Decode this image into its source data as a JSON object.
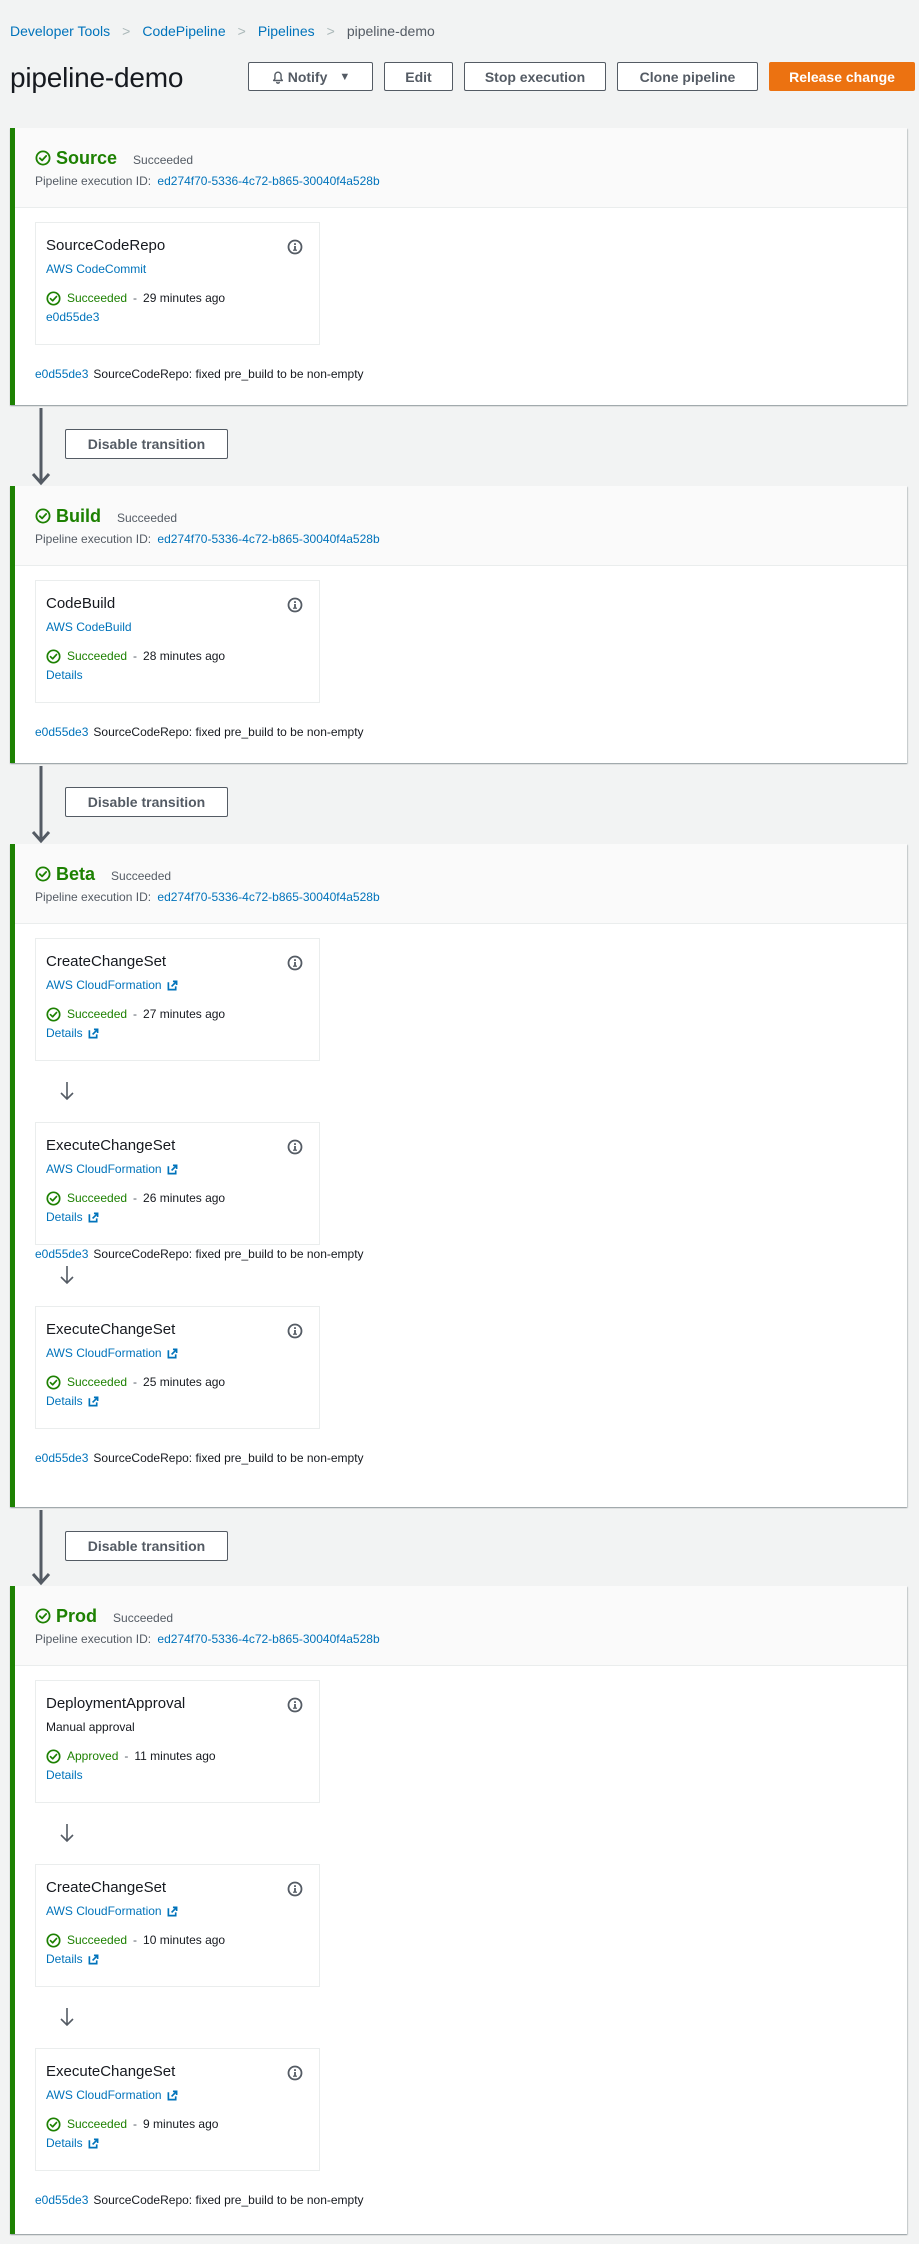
{
  "breadcrumb": [
    {
      "label": "Developer Tools",
      "link": true
    },
    {
      "label": "CodePipeline",
      "link": true
    },
    {
      "label": "Pipelines",
      "link": true
    },
    {
      "label": "pipeline-demo",
      "link": false
    }
  ],
  "page_title": "pipeline-demo",
  "toolbar": {
    "notify_label": "Notify",
    "edit_label": "Edit",
    "stop_label": "Stop execution",
    "clone_label": "Clone pipeline",
    "release_label": "Release change"
  },
  "transition_label": "Disable transition",
  "exec_id_label": "Pipeline execution ID:",
  "colors": {
    "success": "#1d8102",
    "link": "#0073bb",
    "primary": "#ec7211"
  },
  "stages": [
    {
      "name": "Source",
      "status": "Succeeded",
      "execution_id": "ed274f70-5336-4c72-b865-30040f4a528b",
      "actions": [
        {
          "name": "SourceCodeRepo",
          "provider": "AWS CodeCommit",
          "provider_external": false,
          "provider_link": true,
          "status": "Succeeded",
          "time": "29 minutes ago",
          "detail": "e0d55de3",
          "detail_external": false
        }
      ],
      "commit": {
        "id": "e0d55de3",
        "message": "SourceCodeRepo: fixed pre_build to be non-empty"
      }
    },
    {
      "name": "Build",
      "status": "Succeeded",
      "execution_id": "ed274f70-5336-4c72-b865-30040f4a528b",
      "actions": [
        {
          "name": "CodeBuild",
          "provider": "AWS CodeBuild",
          "provider_external": false,
          "provider_link": true,
          "status": "Succeeded",
          "time": "28 minutes ago",
          "detail": "Details",
          "detail_external": false
        }
      ],
      "commit": {
        "id": "e0d55de3",
        "message": "SourceCodeRepo: fixed pre_build to be non-empty"
      }
    },
    {
      "name": "Beta",
      "status": "Succeeded",
      "execution_id": "ed274f70-5336-4c72-b865-30040f4a528b",
      "actions": [
        {
          "name": "CreateChangeSet",
          "provider": "AWS CloudFormation",
          "provider_external": true,
          "provider_link": true,
          "status": "Succeeded",
          "time": "27 minutes ago",
          "detail": "Details",
          "detail_external": true
        },
        {
          "name": "ExecuteChangeSet",
          "provider": "AWS CloudFormation",
          "provider_external": true,
          "provider_link": true,
          "status": "Succeeded",
          "time": "26 minutes ago",
          "detail": "Details",
          "detail_external": true
        },
        {
          "name": "ExecuteChangeSet",
          "provider": "AWS CloudFormation",
          "provider_external": true,
          "provider_link": true,
          "status": "Succeeded",
          "time": "25 minutes ago",
          "detail": "Details",
          "detail_external": true
        }
      ],
      "overlay_commit": {
        "id": "e0d55de3",
        "message": "SourceCodeRepo: fixed pre_build to be non-empty"
      },
      "commit": {
        "id": "e0d55de3",
        "message": "SourceCodeRepo: fixed pre_build to be non-empty"
      }
    },
    {
      "name": "Prod",
      "status": "Succeeded",
      "execution_id": "ed274f70-5336-4c72-b865-30040f4a528b",
      "actions": [
        {
          "name": "DeploymentApproval",
          "provider": "Manual approval",
          "provider_external": false,
          "provider_link": false,
          "status": "Approved",
          "time": "11 minutes ago",
          "detail": "Details",
          "detail_external": false
        },
        {
          "name": "CreateChangeSet",
          "provider": "AWS CloudFormation",
          "provider_external": true,
          "provider_link": true,
          "status": "Succeeded",
          "time": "10 minutes ago",
          "detail": "Details",
          "detail_external": true
        },
        {
          "name": "ExecuteChangeSet",
          "provider": "AWS CloudFormation",
          "provider_external": true,
          "provider_link": true,
          "status": "Succeeded",
          "time": "9 minutes ago",
          "detail": "Details",
          "detail_external": true
        }
      ],
      "commit": {
        "id": "e0d55de3",
        "message": "SourceCodeRepo: fixed pre_build to be non-empty"
      }
    }
  ]
}
